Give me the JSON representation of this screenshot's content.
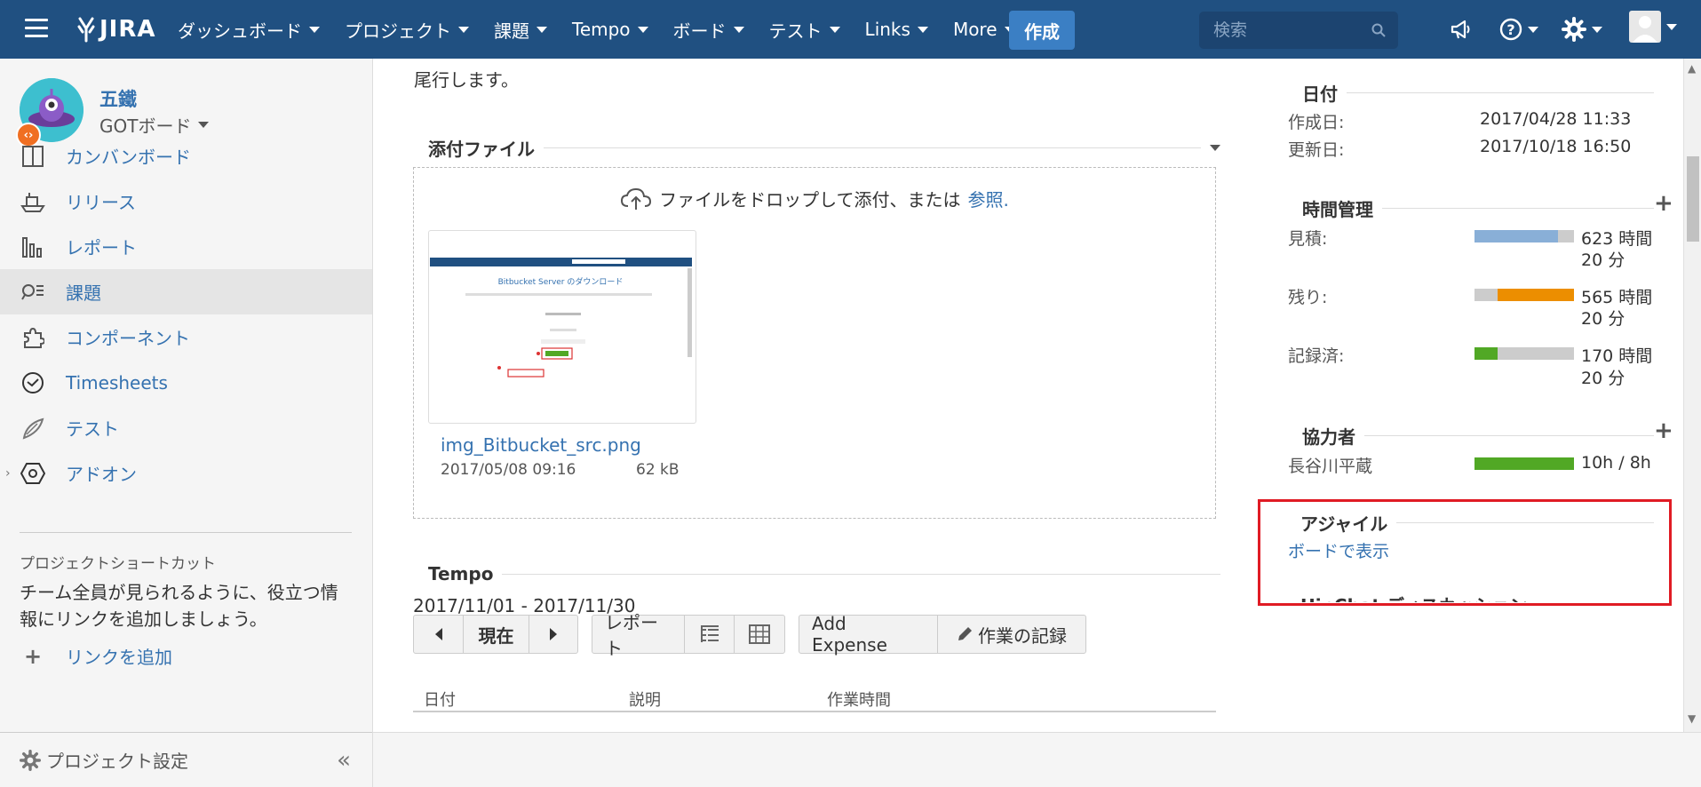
{
  "nav": {
    "items": [
      {
        "label": "ダッシュボード"
      },
      {
        "label": "プロジェクト"
      },
      {
        "label": "課題"
      },
      {
        "label": "Tempo"
      },
      {
        "label": "ボード"
      },
      {
        "label": "テスト"
      },
      {
        "label": "Links"
      },
      {
        "label": "More"
      }
    ],
    "logo_text": "JIRA",
    "create_label": "作成",
    "search_placeholder": "検索"
  },
  "sidebar": {
    "project_name": "五鐵",
    "board_name": "GOTボード",
    "items": [
      {
        "label": "カンバンボード",
        "icon": "kanban-icon"
      },
      {
        "label": "リリース",
        "icon": "release-ship-icon"
      },
      {
        "label": "レポート",
        "icon": "report-chart-icon"
      },
      {
        "label": "課題",
        "icon": "issues-search-icon"
      },
      {
        "label": "コンポーネント",
        "icon": "component-puzzle-icon"
      },
      {
        "label": "Timesheets",
        "icon": "clock-icon"
      },
      {
        "label": "テスト",
        "icon": "test-feather-icon"
      },
      {
        "label": "アドオン",
        "icon": "addon-hexagon-icon"
      }
    ],
    "shortcut_title": "プロジェクトショートカット",
    "shortcut_desc": "チーム全員が見られるように、役立つ情報にリンクを追加しましょう。",
    "add_link_label": "リンクを追加",
    "settings_label": "プロジェクト設定"
  },
  "main": {
    "trail_text": "尾行します。",
    "attachments": {
      "title": "添付ファイル",
      "drop_text": "ファイルをドロップして添付、または",
      "browse_label": "参照.",
      "file": {
        "name": "img_Bitbucket_src.png",
        "date": "2017/05/08 09:16",
        "size": "62 kB",
        "preview_title": "Bitbucket Server のダウンロード"
      }
    },
    "tempo": {
      "title": "Tempo",
      "range": "2017/11/01 - 2017/11/30",
      "current_label": "現在",
      "report_label": "レポート",
      "add_expense_label": "Add Expense",
      "log_work_label": "作業の記録",
      "columns": [
        "日付",
        "説明",
        "作業時間"
      ]
    }
  },
  "details": {
    "dates": {
      "title": "日付",
      "created_label": "作成日:",
      "created_value": "2017/04/28 11:33",
      "updated_label": "更新日:",
      "updated_value": "2017/10/18 16:50"
    },
    "time_tracking": {
      "title": "時間管理",
      "estimate_label": "見積:",
      "estimate_value_1": "623 時間",
      "estimate_value_2": "20 分",
      "estimate_fraction": 0.84,
      "remaining_label": "残り:",
      "remaining_value_1": "565 時間",
      "remaining_value_2": "20 分",
      "remaining_fraction": 0.77,
      "logged_label": "記録済:",
      "logged_value_1": "170 時間",
      "logged_value_2": "20 分",
      "logged_fraction": 0.23
    },
    "collaborators": {
      "title": "協力者",
      "name": "長谷川平蔵",
      "value": "10h / 8h",
      "fraction": 1.0
    },
    "agile": {
      "title": "アジャイル",
      "link_label": "ボードで表示"
    },
    "cut_title": "HipChat ディスカッション"
  },
  "colors": {
    "nav_bg": "#205081",
    "accent_link": "#3572b0",
    "estimate_bar": "#89afd7",
    "remaining_bar": "#ec8e00",
    "logged_bar": "#51a825",
    "highlight": "#e01b24"
  }
}
